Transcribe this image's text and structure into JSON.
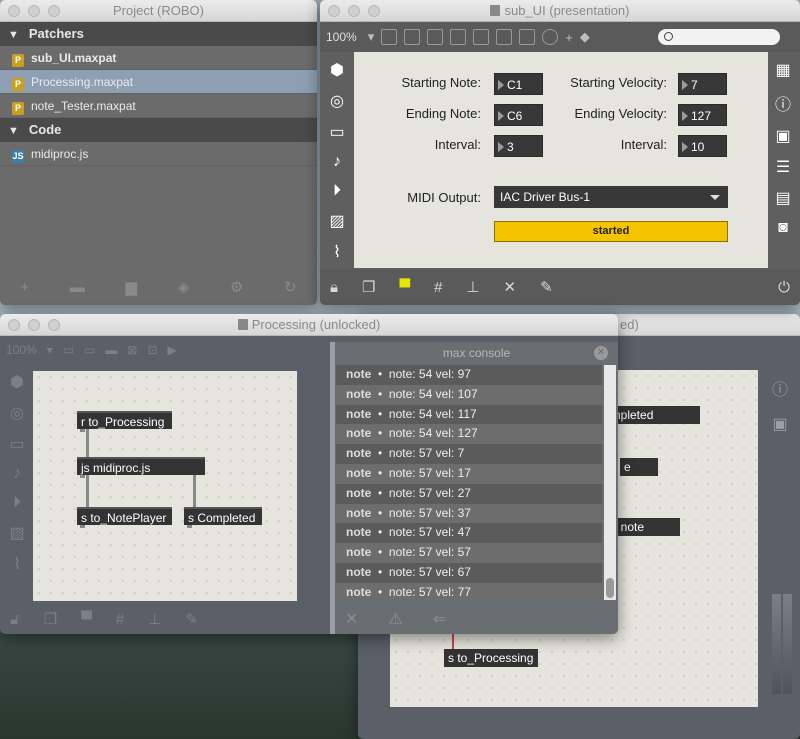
{
  "project_window": {
    "title": "Project (ROBO)",
    "sections": [
      {
        "label": "Patchers",
        "items": [
          {
            "label": "sub_UI.maxpat",
            "type": "P",
            "bold": true
          },
          {
            "label": "Processing.maxpat",
            "type": "P",
            "selected": true
          },
          {
            "label": "note_Tester.maxpat",
            "type": "P"
          }
        ]
      },
      {
        "label": "Code",
        "items": [
          {
            "label": "midiproc.js",
            "type": "JS"
          }
        ]
      }
    ]
  },
  "subui_window": {
    "title": "sub_UI (presentation)",
    "zoom": "100%",
    "fields": {
      "starting_note_label": "Starting Note:",
      "starting_note": "C1",
      "ending_note_label": "Ending Note:",
      "ending_note": "C6",
      "interval_label_left": "Interval:",
      "interval_left": "3",
      "starting_velocity_label": "Starting Velocity:",
      "starting_velocity": "7",
      "ending_velocity_label": "Ending Velocity:",
      "ending_velocity": "127",
      "interval_label_right": "Interval:",
      "interval_right": "10",
      "midi_output_label": "MIDI Output:",
      "midi_output": "IAC Driver Bus-1",
      "started_label": "started"
    },
    "accent": "#f5c400"
  },
  "processing_window": {
    "title": "Processing (unlocked)",
    "zoom": "100%",
    "objects": {
      "receive": "r to_Processing",
      "js": "js midiproc.js",
      "send_noteplayer": "s to_NotePlayer",
      "send_completed": "s Completed"
    },
    "console": {
      "title": "max console",
      "rows": [
        {
          "source": "note",
          "message": "note: 54 vel: 97"
        },
        {
          "source": "note",
          "message": "note: 54 vel: 107"
        },
        {
          "source": "note",
          "message": "note: 54 vel: 117"
        },
        {
          "source": "note",
          "message": "note: 54 vel: 127"
        },
        {
          "source": "note",
          "message": "note: 57 vel: 7"
        },
        {
          "source": "note",
          "message": "note: 57 vel: 17"
        },
        {
          "source": "note",
          "message": "note: 57 vel: 27"
        },
        {
          "source": "note",
          "message": "note: 57 vel: 37"
        },
        {
          "source": "note",
          "message": "note: 57 vel: 47"
        },
        {
          "source": "note",
          "message": "note: 57 vel: 57"
        },
        {
          "source": "note",
          "message": "note: 57 vel: 67"
        },
        {
          "source": "note",
          "message": "note: 57 vel: 77"
        }
      ]
    }
  },
  "tester_window": {
    "title_fragment": "ed)",
    "objects": {
      "completed": "ompleted",
      "e": "e",
      "note": "t note",
      "send_processing": "s to_Processing"
    }
  }
}
